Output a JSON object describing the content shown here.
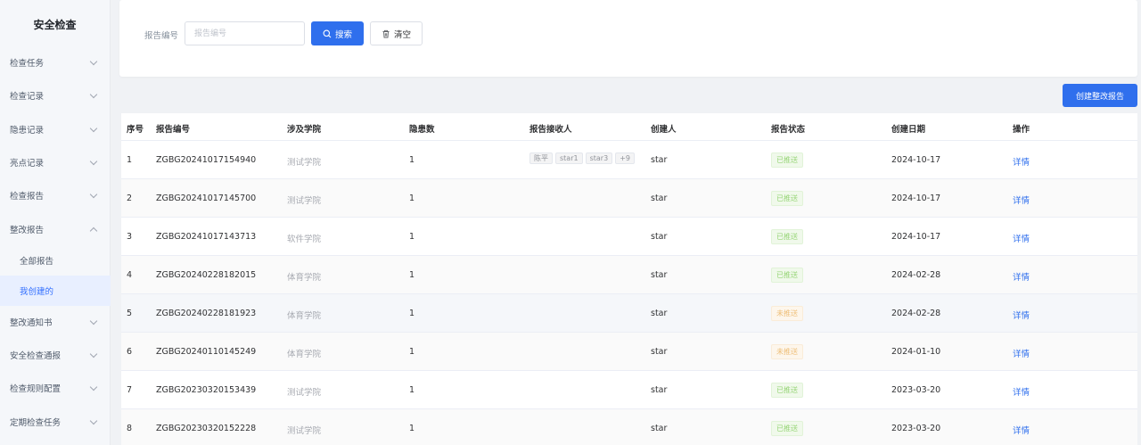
{
  "sidebar": {
    "title": "安全检查",
    "items": [
      {
        "label": "检查任务",
        "chevron": "down"
      },
      {
        "label": "检查记录",
        "chevron": "down"
      },
      {
        "label": "隐患记录",
        "chevron": "down"
      },
      {
        "label": "亮点记录",
        "chevron": "down"
      },
      {
        "label": "检查报告",
        "chevron": "down"
      },
      {
        "label": "整改报告",
        "chevron": "up"
      },
      {
        "label": "全部报告",
        "sub": true
      },
      {
        "label": "我创建的",
        "sub": true,
        "active": true
      },
      {
        "label": "整改通知书",
        "chevron": "down"
      },
      {
        "label": "安全检查通报",
        "chevron": "down"
      },
      {
        "label": "检查规则配置",
        "chevron": "down"
      },
      {
        "label": "定期检查任务",
        "chevron": "down"
      }
    ]
  },
  "filter": {
    "label": "报告编号",
    "placeholder": "报告编号",
    "value": "",
    "search_label": "搜索",
    "clear_label": "清空"
  },
  "toolbar": {
    "create_label": "创建整改报告"
  },
  "table": {
    "headers": [
      "序号",
      "报告编号",
      "涉及学院",
      "隐患数",
      "报告接收人",
      "创建人",
      "报告状态",
      "创建日期",
      "操作"
    ],
    "rows": [
      {
        "index": "1",
        "code": "ZGBG20241017154940",
        "college": "测试学院",
        "hazards": "1",
        "receivers": [
          "陈平",
          "star1",
          "star3",
          "+9"
        ],
        "creator": "star",
        "status": "已推送",
        "status_type": "pushed",
        "date": "2024-10-17",
        "action": "详情"
      },
      {
        "index": "2",
        "code": "ZGBG20241017145700",
        "college": "测试学院",
        "hazards": "1",
        "receivers": [],
        "creator": "star",
        "status": "已推送",
        "status_type": "pushed",
        "date": "2024-10-17",
        "action": "详情"
      },
      {
        "index": "3",
        "code": "ZGBG20241017143713",
        "college": "软件学院",
        "hazards": "1",
        "receivers": [],
        "creator": "star",
        "status": "已推送",
        "status_type": "pushed",
        "date": "2024-10-17",
        "action": "详情"
      },
      {
        "index": "4",
        "code": "ZGBG20240228182015",
        "college": "体育学院",
        "hazards": "1",
        "receivers": [],
        "creator": "star",
        "status": "已推送",
        "status_type": "pushed",
        "date": "2024-02-28",
        "action": "详情"
      },
      {
        "index": "5",
        "code": "ZGBG20240228181923",
        "college": "体育学院",
        "hazards": "1",
        "receivers": [],
        "creator": "star",
        "status": "未推送",
        "status_type": "unpushed",
        "date": "2024-02-28",
        "action": "详情"
      },
      {
        "index": "6",
        "code": "ZGBG20240110145249",
        "college": "体育学院",
        "hazards": "1",
        "receivers": [],
        "creator": "star",
        "status": "未推送",
        "status_type": "unpushed",
        "date": "2024-01-10",
        "action": "详情"
      },
      {
        "index": "7",
        "code": "ZGBG20230320153439",
        "college": "测试学院",
        "hazards": "1",
        "receivers": [],
        "creator": "star",
        "status": "已推送",
        "status_type": "pushed",
        "date": "2023-03-20",
        "action": "详情"
      },
      {
        "index": "8",
        "code": "ZGBG20230320152228",
        "college": "测试学院",
        "hazards": "1",
        "receivers": [],
        "creator": "star",
        "status": "已推送",
        "status_type": "pushed",
        "date": "2023-03-20",
        "action": "详情"
      }
    ]
  },
  "colors": {
    "primary": "#2f6fed",
    "pushed": "#95d475",
    "unpushed": "#eebe77",
    "active_menu_bg": "#e8efff"
  }
}
